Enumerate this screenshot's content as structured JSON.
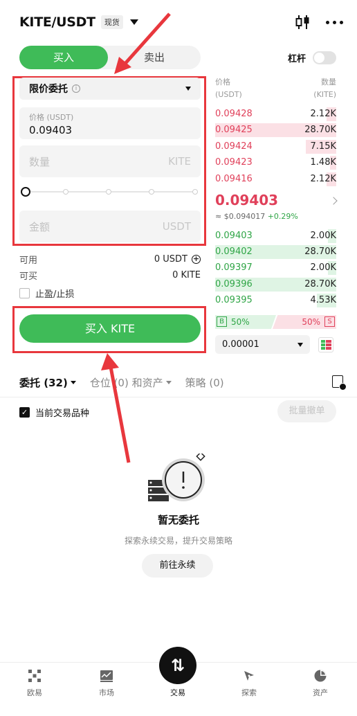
{
  "header": {
    "pair": "KITE/USDT",
    "market_badge": "现货"
  },
  "side_toggle": {
    "buy": "买入",
    "sell": "卖出"
  },
  "leverage_label": "杠杆",
  "order_form": {
    "order_type": "限价委托",
    "price_label": "价格 (USDT)",
    "price_value": "0.09403",
    "qty_placeholder": "数量",
    "qty_unit": "KITE",
    "amount_placeholder": "金额",
    "amount_unit": "USDT",
    "available_label": "可用",
    "available_value": "0 USDT",
    "buyable_label": "可买",
    "buyable_value": "0 KITE",
    "tpsl_label": "止盈/止损",
    "submit_label": "买入 KITE"
  },
  "orderbook": {
    "price_header": "价格",
    "price_unit": "(USDT)",
    "qty_header": "数量",
    "qty_unit": "(KITE)",
    "asks": [
      {
        "price": "0.09428",
        "qty": "2.12K",
        "depth": 0.08
      },
      {
        "price": "0.09425",
        "qty": "28.70K",
        "depth": 1.0
      },
      {
        "price": "0.09424",
        "qty": "7.15K",
        "depth": 0.25
      },
      {
        "price": "0.09423",
        "qty": "1.48K",
        "depth": 0.05
      },
      {
        "price": "0.09416",
        "qty": "2.12K",
        "depth": 0.08
      }
    ],
    "last_price": "0.09403",
    "fiat_price": "≈ $0.094017",
    "change": "+0.29%",
    "bids": [
      {
        "price": "0.09403",
        "qty": "2.00K",
        "depth": 0.07
      },
      {
        "price": "0.09402",
        "qty": "28.70K",
        "depth": 1.0
      },
      {
        "price": "0.09397",
        "qty": "2.00K",
        "depth": 0.07
      },
      {
        "price": "0.09396",
        "qty": "28.70K",
        "depth": 1.0
      },
      {
        "price": "0.09395",
        "qty": "4.53K",
        "depth": 0.16
      }
    ],
    "buy_letter": "B",
    "buy_ratio": "50%",
    "sell_ratio": "50%",
    "sell_letter": "S",
    "precision": "0.00001"
  },
  "tabs": {
    "orders": "委托 (32)",
    "positions": "仓位 (0) 和资产",
    "strategies": "策略 (0)"
  },
  "current_pair_only": "当前交易品种",
  "batch_cancel": "批量撤单",
  "empty": {
    "title": "暂无委托",
    "subtitle": "探索永续交易，提升交易策略",
    "action": "前往永续"
  },
  "nav": {
    "home": "欧易",
    "markets": "市场",
    "trade": "交易",
    "discover": "探索",
    "assets": "资产"
  },
  "colors": {
    "buy": "#3fbb58",
    "sell": "#e0405a",
    "highlight": "#e8373d"
  }
}
